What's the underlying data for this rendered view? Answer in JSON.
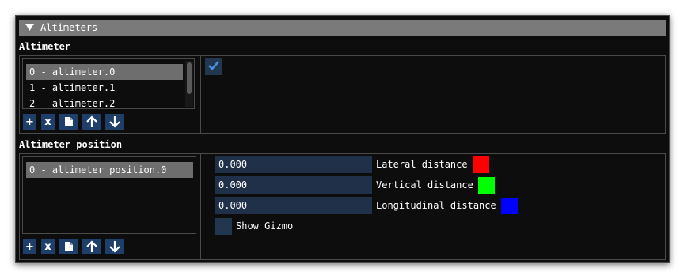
{
  "header": {
    "collapse_icon": "triangle-down-icon",
    "title": "Altimeters"
  },
  "altimeter": {
    "section_title": "Altimeter",
    "items": [
      "0 - altimeter.0",
      "1 - altimeter.1",
      "2 - altimeter.2"
    ],
    "selected_index": 0,
    "enabled_checked": true
  },
  "toolbar": {
    "add_label": "+",
    "remove_label": "x",
    "icons": [
      "copy-icon",
      "arrow-up-icon",
      "arrow-down-icon"
    ]
  },
  "position": {
    "section_title": "Altimeter position",
    "items": [
      "0 - altimeter_position.0"
    ],
    "selected_index": 0,
    "fields": [
      {
        "value": "0.000",
        "label": "Lateral distance",
        "color": "#ff0000"
      },
      {
        "value": "0.000",
        "label": "Vertical distance",
        "color": "#00ff00"
      },
      {
        "value": "0.000",
        "label": "Longitudinal distance",
        "color": "#0000ff"
      }
    ],
    "show_gizmo_label": "Show Gizmo",
    "show_gizmo_checked": false
  },
  "colors": {
    "accent": "#1f3f6a",
    "input_bg": "#1f3048",
    "selection": "#6e6e6e",
    "header_bg": "#7a7a7a"
  }
}
